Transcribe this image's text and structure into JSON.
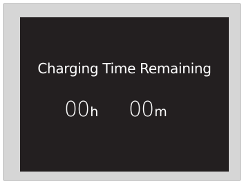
{
  "display": {
    "title": "Charging Time Remaining",
    "hours_value": "00",
    "hours_unit": "h",
    "minutes_value": "00",
    "minutes_unit": "m"
  },
  "colors": {
    "screen_background": "#231f20",
    "text": "#ffffff",
    "frame_background": "#d6d6d6"
  }
}
